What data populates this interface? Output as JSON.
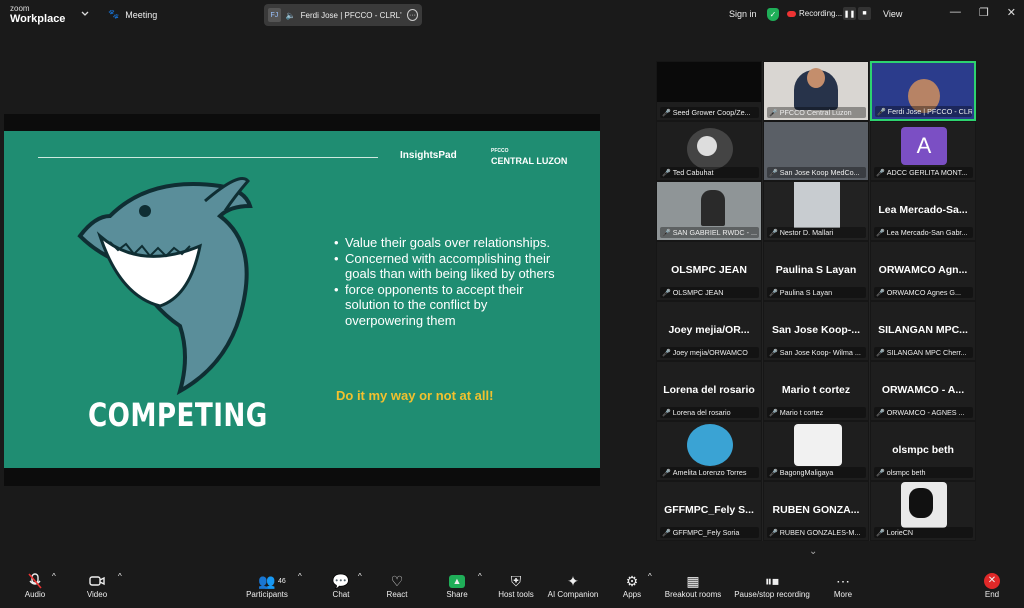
{
  "topbar": {
    "logo_line1": "zoom",
    "logo_line2": "Workplace",
    "meeting_label": "Meeting",
    "speaker_initials": "FJ",
    "speaker_text": "Ferdi Jose | PFCCO - CLRL's s",
    "signin": "Sign in",
    "recording": "Recording...",
    "view": "View"
  },
  "slide": {
    "brand_insights": "InsightsPad",
    "brand_pfcco_small": "PFCCO",
    "brand_pfcco": "CENTRAL LUZON",
    "title": "COMPETING",
    "bullets": [
      "Value their goals over relationships.",
      "Concerned with accomplishing their goals than with being liked by others",
      "force opponents to accept their solution to the conflict by overpowering them"
    ],
    "tagline": "Do it my way or not at all!"
  },
  "gallery": {
    "tiles": [
      {
        "big": "",
        "name": "Seed Grower Coop/Ze..."
      },
      {
        "big": "",
        "name": "PFCCO Central Luzon"
      },
      {
        "big": "",
        "name": "Ferdi Jose | PFCCO - CLRL"
      },
      {
        "big": "",
        "name": "Ted Cabuhat"
      },
      {
        "big": "",
        "name": "San Jose Koop MedCo..."
      },
      {
        "big": "A",
        "name": "ADCC GERLITA MONT..."
      },
      {
        "big": "",
        "name": "SAN GABRIEL RWDC - ..."
      },
      {
        "big": "",
        "name": "Nestor D. Mallari"
      },
      {
        "big": "Lea Mercado-Sa...",
        "name": "Lea Mercado-San Gabr..."
      },
      {
        "big": "OLSMPC JEAN",
        "name": "OLSMPC JEAN"
      },
      {
        "big": "Paulina S Layan",
        "name": "Paulina S Layan"
      },
      {
        "big": "ORWAMCO Agn...",
        "name": "ORWAMCO Agnes G..."
      },
      {
        "big": "Joey mejia/OR...",
        "name": "Joey mejia/ORWAMCO"
      },
      {
        "big": "San Jose Koop-...",
        "name": "San Jose Koop- Wilma ..."
      },
      {
        "big": "SILANGAN MPC...",
        "name": "SILANGAN MPC Cherr..."
      },
      {
        "big": "Lorena del rosario",
        "name": "Lorena del rosario"
      },
      {
        "big": "Mario t cortez",
        "name": "Mario t cortez"
      },
      {
        "big": "ORWAMCO - A...",
        "name": "ORWAMCO - AGNES ..."
      },
      {
        "big": "",
        "name": "Amelita Lorenzo Torres"
      },
      {
        "big": "",
        "name": "BagongMaligaya"
      },
      {
        "big": "olsmpc beth",
        "name": "olsmpc beth"
      },
      {
        "big": "GFFMPC_Fely S...",
        "name": "GFFMPC_Fely Soria"
      },
      {
        "big": "RUBEN GONZA...",
        "name": "RUBEN GONZALES-M..."
      },
      {
        "big": "",
        "name": "LorieCN"
      }
    ]
  },
  "toolbar": {
    "audio": "Audio",
    "video": "Video",
    "participants": "Participants",
    "participants_count": "46",
    "chat": "Chat",
    "react": "React",
    "share": "Share",
    "host_tools": "Host tools",
    "ai_companion": "AI Companion",
    "apps": "Apps",
    "breakout": "Breakout rooms",
    "pause_rec": "Pause/stop recording",
    "more": "More",
    "end": "End"
  },
  "colors": {
    "slide_bg": "#1f8d72",
    "tagline": "#f2c12e",
    "active_border": "#2dd36f",
    "end_red": "#e02828"
  }
}
